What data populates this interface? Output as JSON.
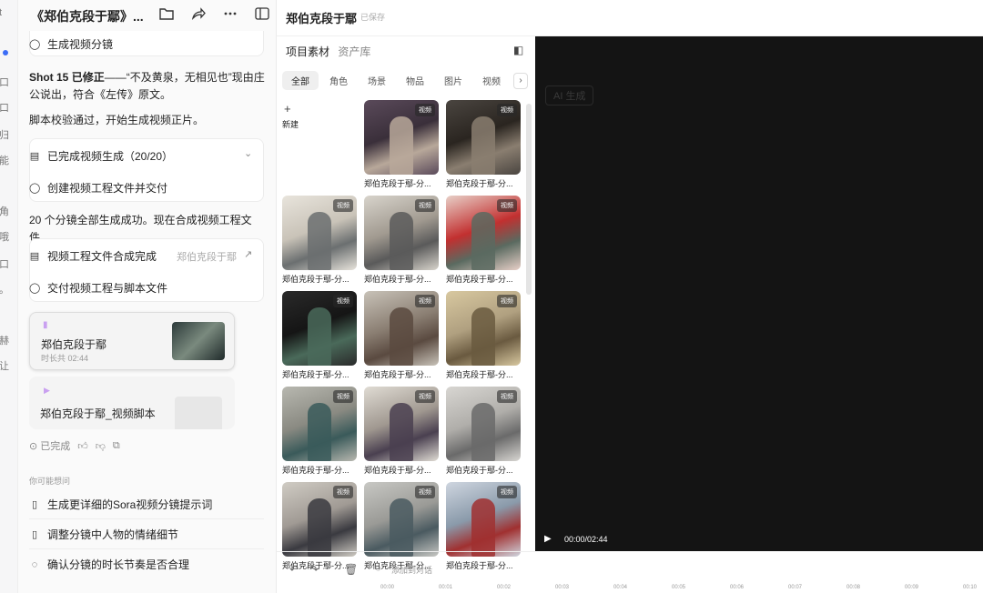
{
  "rail": {
    "glyphs": [
      "t",
      "一",
      "口",
      "归",
      "能",
      "角",
      "哦",
      "口",
      "赫",
      "让",
      "。"
    ]
  },
  "chat": {
    "title": "《郑伯克段于鄢》...",
    "top_step": "生成视频分镜",
    "shot_label": "Shot 15",
    "shot_fixed": "已修正",
    "shot_text": "——“不及黄泉，无相见也”现由庄公说出，符合《左传》原文。",
    "check_text": "脚本校验通过，开始生成视频正片。",
    "card1_row1": "已完成视频生成（20/20）",
    "card1_row2": "创建视频工程文件并交付",
    "done_text": "20 个分镜全部生成成功。现在合成视频工程文件。",
    "card2_row1": "视频工程文件合成完成",
    "card2_link": "郑伯克段于鄢",
    "card2_row2": "交付视频工程与脚本文件",
    "file1_name": "郑伯克段于鄢",
    "file1_meta": "时长共 02:44",
    "file2_name": "郑伯克段于鄢_视频脚本",
    "status": "已完成",
    "suggest_label": "你可能想问",
    "suggestions": [
      "生成更详细的Sora视频分镜提示词",
      "调整分镜中人物的情绪细节",
      "确认分镜的时长节奏是否合理"
    ]
  },
  "topbar": {
    "title": "郑伯克段于鄢",
    "saved": "已保存"
  },
  "panel": {
    "tab_project": "项目素材",
    "tab_library": "资产库",
    "filters": [
      "全部",
      "角色",
      "场景",
      "物品",
      "图片",
      "视频"
    ],
    "new_label": "新建",
    "badge": "视频",
    "caption": "郑伯克段于鄢-分...",
    "add_to_chat": "添加到对话"
  },
  "preview": {
    "watermark": "AI 生成",
    "time": "00:00/02:44"
  },
  "timeline": {
    "ticks": [
      "00:00",
      "00:01",
      "00:02",
      "00:03",
      "00:04",
      "00:05",
      "00:06",
      "00:07",
      "00:08",
      "00:09",
      "00:10"
    ]
  },
  "colors": {
    "accent": "#3b6cf6",
    "preview_bg": "#141414",
    "purple": "#c9a0f0"
  }
}
